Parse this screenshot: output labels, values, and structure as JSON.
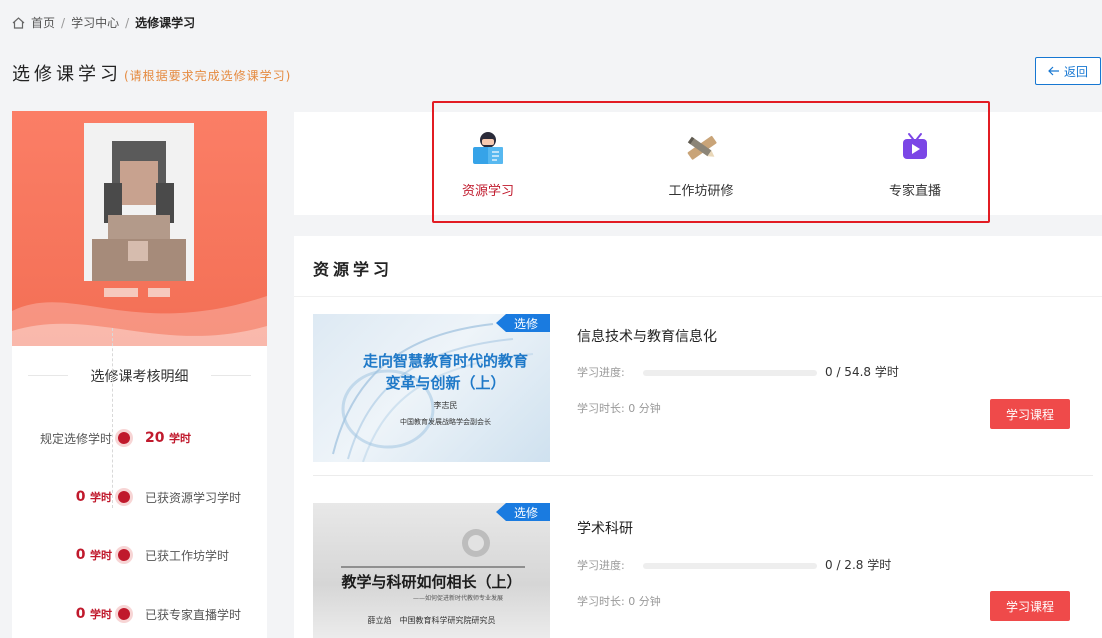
{
  "breadcrumb": {
    "home": "首页",
    "sep": "/",
    "center": "学习中心",
    "current": "选修课学习"
  },
  "page": {
    "title": "选修课学习",
    "hint": "(请根据要求完成选修课学习)",
    "back_label": "返回"
  },
  "profile": {
    "detail_title": "选修课考核明细",
    "rows": [
      {
        "left_label": "规定选修学时",
        "hours_value": "20",
        "hours_unit": "学时"
      },
      {
        "hours_value": "0",
        "hours_unit": "学时",
        "right_label": "已获资源学习学时"
      },
      {
        "hours_value": "0",
        "hours_unit": "学时",
        "right_label": "已获工作坊学时"
      },
      {
        "hours_value": "0",
        "hours_unit": "学时",
        "right_label": "已获专家直播学时"
      }
    ]
  },
  "tabs": [
    {
      "label": "资源学习",
      "icon": "reader-icon",
      "active": true
    },
    {
      "label": "工作坊研修",
      "icon": "pencil-ruler-icon",
      "active": false
    },
    {
      "label": "专家直播",
      "icon": "tv-play-icon",
      "active": false
    }
  ],
  "section": {
    "title": "资源学习"
  },
  "courses": [
    {
      "tag": "选修",
      "title": "信息技术与教育信息化",
      "progress_label": "学习进度:",
      "progress_fraction": 0,
      "progress_text": "0 / 54.8 学时",
      "time_label": "学习时长: 0 分钟",
      "button": "学习课程",
      "thumb": {
        "line1": "走向智慧教育时代的教育",
        "line2": "变革与创新（上）",
        "author": "李志民",
        "affiliation": "中国教育发展战略学会副会长"
      }
    },
    {
      "tag": "选修",
      "title": "学术科研",
      "progress_label": "学习进度:",
      "progress_fraction": 0,
      "progress_text": "0 / 2.8 学时",
      "time_label": "学习时长: 0 分钟",
      "button": "学习课程",
      "thumb": {
        "line1": "教学与科研如何相长（上）",
        "subtitle": "——如何促进新时代教师专业发展",
        "author": "薛立焰　中国教育科学研究院研究员"
      }
    }
  ],
  "colors": {
    "accent_red": "#c0192c",
    "button_red": "#ef4a4a",
    "tag_blue": "#1a7be0",
    "banner_orange": "#f36f55",
    "hint_orange": "#e58a3f",
    "highlight_border": "#e21c23"
  }
}
